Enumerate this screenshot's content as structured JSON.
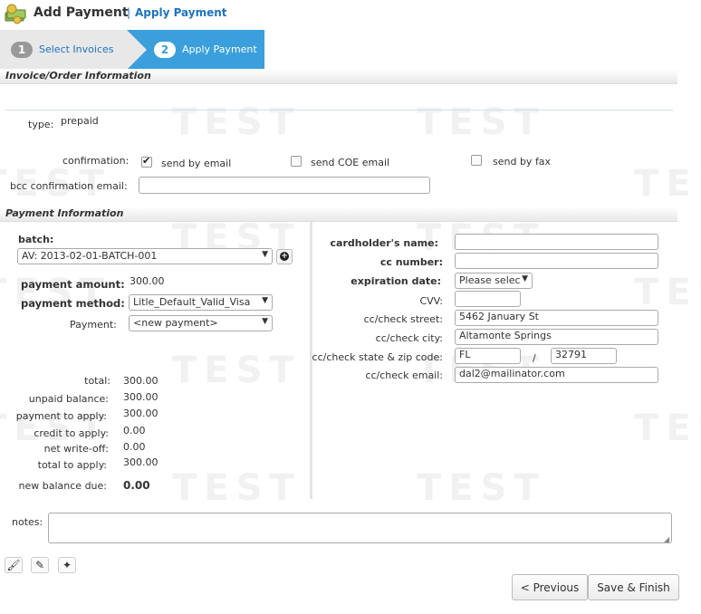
{
  "header": {
    "title": "Add Payment",
    "separator": "|",
    "link": "Apply Payment"
  },
  "steps": [
    {
      "num": "1",
      "label": "Select Invoices"
    },
    {
      "num": "2",
      "label": "Apply Payment"
    }
  ],
  "invoice_section": {
    "title": "Invoice/Order Information",
    "type_label": "type:",
    "type_value": "prepaid",
    "confirmation_label": "confirmation:",
    "options": [
      {
        "label": "send by email",
        "checked": true
      },
      {
        "label": "send COE email",
        "checked": false
      },
      {
        "label": "send by fax",
        "checked": false
      }
    ],
    "bcc_label": "bcc confirmation email:",
    "bcc_value": ""
  },
  "payment_section": {
    "title": "Payment Information",
    "batch_label": "batch:",
    "batch_value": "AV: 2013-02-01-BATCH-001",
    "amount_label": "payment amount:",
    "amount_value": "300.00",
    "method_label": "payment method:",
    "method_value": "Litle_Default_Valid_Visa",
    "payment_label": "Payment:",
    "payment_value": "<new payment>",
    "totals": [
      {
        "label": "total:",
        "value": "300.00"
      },
      {
        "label": "unpaid balance:",
        "value": "300.00"
      },
      {
        "label": "payment to apply:",
        "value": "300.00"
      },
      {
        "label": "credit to apply:",
        "value": "0.00"
      },
      {
        "label": "net write-off:",
        "value": "0.00"
      },
      {
        "label": "total to apply:",
        "value": "300.00"
      }
    ],
    "new_balance_label": "new balance due:",
    "new_balance_value": "0.00",
    "card": {
      "name_label": "cardholder's name:",
      "name_value": "",
      "number_label": "cc number:",
      "number_value": "",
      "exp_label": "expiration date:",
      "exp_value": "Please selec",
      "cvv_label": "CVV:",
      "cvv_value": "",
      "street_label": "cc/check street:",
      "street_value": "5462 January St",
      "city_label": "cc/check city:",
      "city_value": "Altamonte Springs",
      "statezip_label": "cc/check state & zip code:",
      "state_value": "FL",
      "zip_sep": "/",
      "zip_value": "32791",
      "email_label": "cc/check email:",
      "email_value": "dal2@mailinator.com"
    }
  },
  "notes_label": "notes:",
  "notes_value": "",
  "watermark": "TEST",
  "buttons": {
    "previous": "< Previous",
    "finish": "Save & Finish"
  },
  "colors": {
    "accent": "#3a9fdb",
    "link": "#1e73be"
  }
}
